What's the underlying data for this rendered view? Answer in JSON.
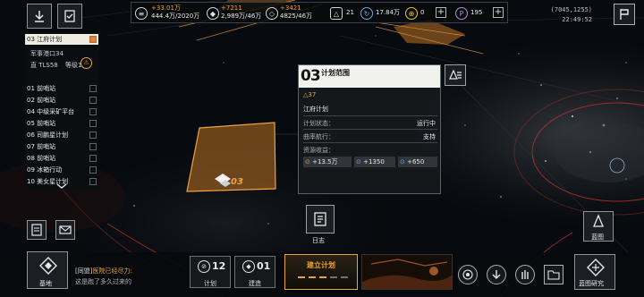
{
  "resources": {
    "r1": {
      "delta": "+33.01万",
      "value": "444.4万/2020万"
    },
    "r2": {
      "delta": "+7211",
      "value": "2,989万/46万"
    },
    "r3": {
      "delta": "+3421",
      "value": "4825/46万"
    },
    "r4": {
      "value": "21"
    },
    "r5": {
      "value": "17.84万"
    },
    "r6": {
      "value": "0"
    },
    "r7": {
      "value": "195"
    },
    "plus": "+"
  },
  "coords": {
    "position": "(7045,1255)",
    "time": "22:49:52"
  },
  "leftlist": {
    "items": [
      {
        "label": "03 江府计划",
        "active": true
      },
      {
        "label": "01 前哨站",
        "active": false
      },
      {
        "label": "02 前哨站",
        "active": false
      },
      {
        "label": "04 中级采矿平台",
        "active": false
      },
      {
        "label": "05 前哨站",
        "active": false
      },
      {
        "label": "06 司鹏星计划",
        "active": false
      },
      {
        "label": "07 前哨站",
        "active": false
      },
      {
        "label": "08 前哨站",
        "active": false
      },
      {
        "label": "09 冰箱行动",
        "active": false
      },
      {
        "label": "10 美女星计划",
        "active": false
      }
    ],
    "sub1": "军事港口34",
    "sub2": "直 TLS58",
    "sub2b": "等级1"
  },
  "map": {
    "plot_label": "03"
  },
  "panel": {
    "number": "03",
    "title": "计划范围",
    "level": "△37",
    "name": "江府计划",
    "rows": [
      {
        "label": "计划状态：",
        "value": "运行中"
      },
      {
        "label": "曲率航行：",
        "value": "支持"
      }
    ],
    "income_label": "资源收益：",
    "gains": [
      "+13.5万",
      "+1350",
      "+650"
    ]
  },
  "log": {
    "label": "日志"
  },
  "bottom": {
    "base_label": "基地",
    "chat_prefix": "[同盟]",
    "chat_highlight": "医院已经尽力:",
    "chat_line2": "这是跑了多久过来的",
    "plan_count": "12",
    "plan_label": "计划",
    "build_count": "01",
    "build_label": "建造",
    "establish_plan": "建立计划",
    "research_label": "蓝图研究",
    "blueprint_label": "蓝图"
  },
  "colors": {
    "accent": "#e8a23a",
    "panel": "#16191c",
    "danger": "#c0392b"
  }
}
